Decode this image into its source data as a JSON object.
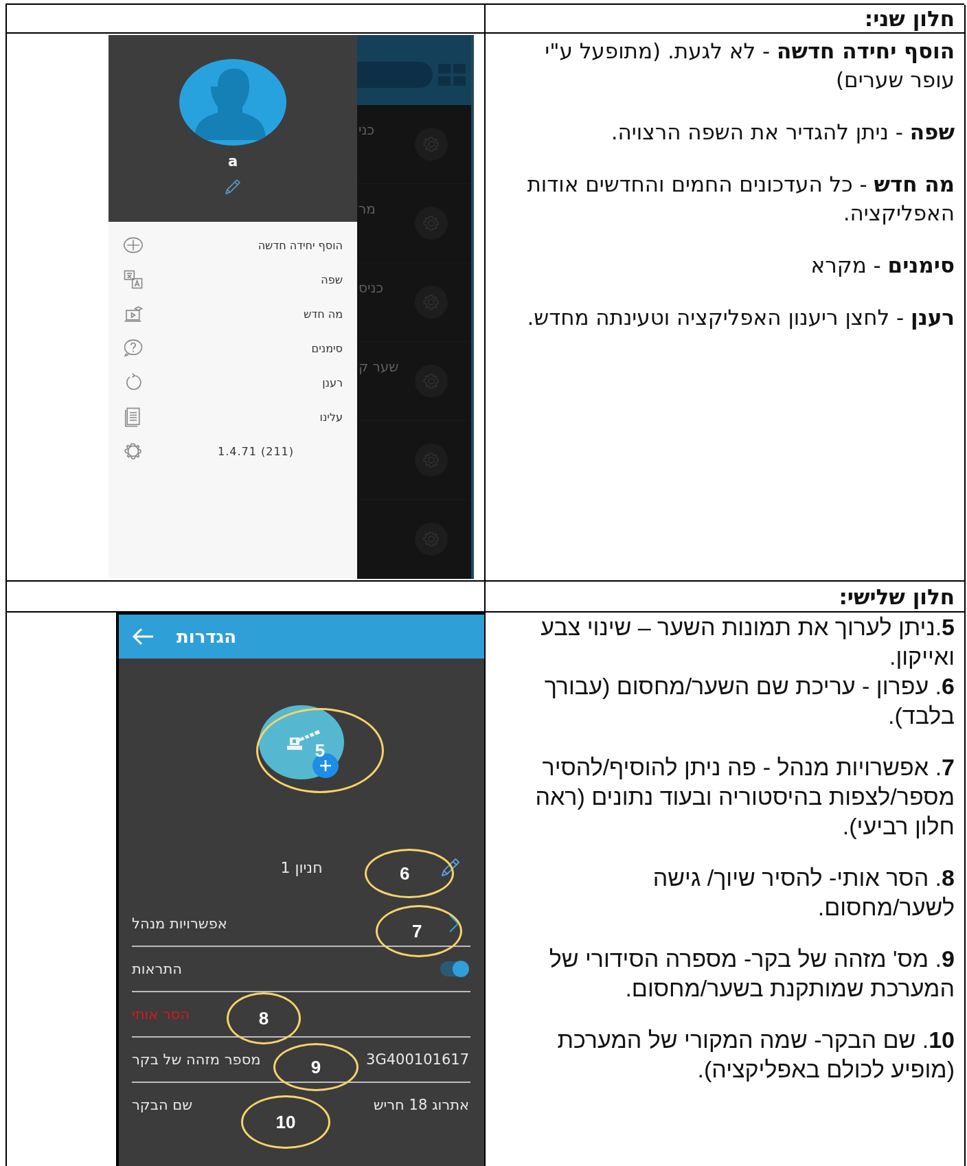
{
  "sections": [
    {
      "heading": "חלון שני:",
      "kind": "drawer",
      "screen": {
        "profile_name": "a",
        "menu": [
          {
            "kind": "item",
            "label": "הוסף יחידה חדשה"
          },
          {
            "kind": "item",
            "label": "שפה"
          },
          {
            "kind": "item",
            "label": "מה חדש"
          },
          {
            "kind": "item",
            "label": "סימנים"
          },
          {
            "kind": "item",
            "label": "רענן"
          },
          {
            "kind": "item",
            "label": "עלינו"
          },
          {
            "kind": "version",
            "label": "1.4.71 (211)"
          }
        ],
        "background_labels": [
          "כני",
          "מר",
          "כניס",
          "שער ק"
        ]
      },
      "notes": [
        "**הוסף יחידה חדשה** - לא לגעת. (מתופעל ע\"י עופר שערים)",
        "**שפה** - ניתן להגדיר את השפה הרצויה.",
        "**מה חדש** - כל העדכונים החמים והחדשים אודות האפליקציה.",
        "**סימנים** - מקרא",
        "**רענן** - לחצן ריענון האפליקציה וטעינתה מחדש."
      ]
    },
    {
      "heading": "חלון שלישי:",
      "kind": "settings",
      "screen": {
        "title": "הגדרות",
        "gate_name": "חניון 1",
        "rows": [
          {
            "kind": "link",
            "label": "אפשרויות מנהל"
          },
          {
            "kind": "toggle",
            "label": "התראות",
            "on": true
          },
          {
            "kind": "danger",
            "label": "הסר אותי"
          },
          {
            "kind": "value",
            "label": "מספר מזהה של בקר",
            "value": "3G400101617"
          },
          {
            "kind": "value",
            "label": "שם הבקר",
            "value": "אתרוג 18 חריש"
          }
        ],
        "callouts": [
          "5",
          "6",
          "7",
          "8",
          "9",
          "10"
        ]
      },
      "notes": [
        "**5**.ניתן לערוך את תמונות השער – שינוי צבע ואייקון.",
        "**6**. עפרון - עריכת שם השער/מחסום (עבורך בלבד).",
        "**7**. אפשרויות מנהל - פה ניתן להוסיף/להסיר מספר/לצפות בהיסטוריה ובעוד נתונים (ראה חלון רביעי).",
        "**8**. הסר אותי- להסיר שיוך/ גישה לשער/מחסום.",
        "**9**. מס' מזהה של בקר- מספרה הסידורי של המערכת שמותקנת בשער/מחסום.",
        "**10**. שם הבקר- שמה המקורי של המערכת (מופיע לכולם באפליקציה)."
      ]
    }
  ]
}
